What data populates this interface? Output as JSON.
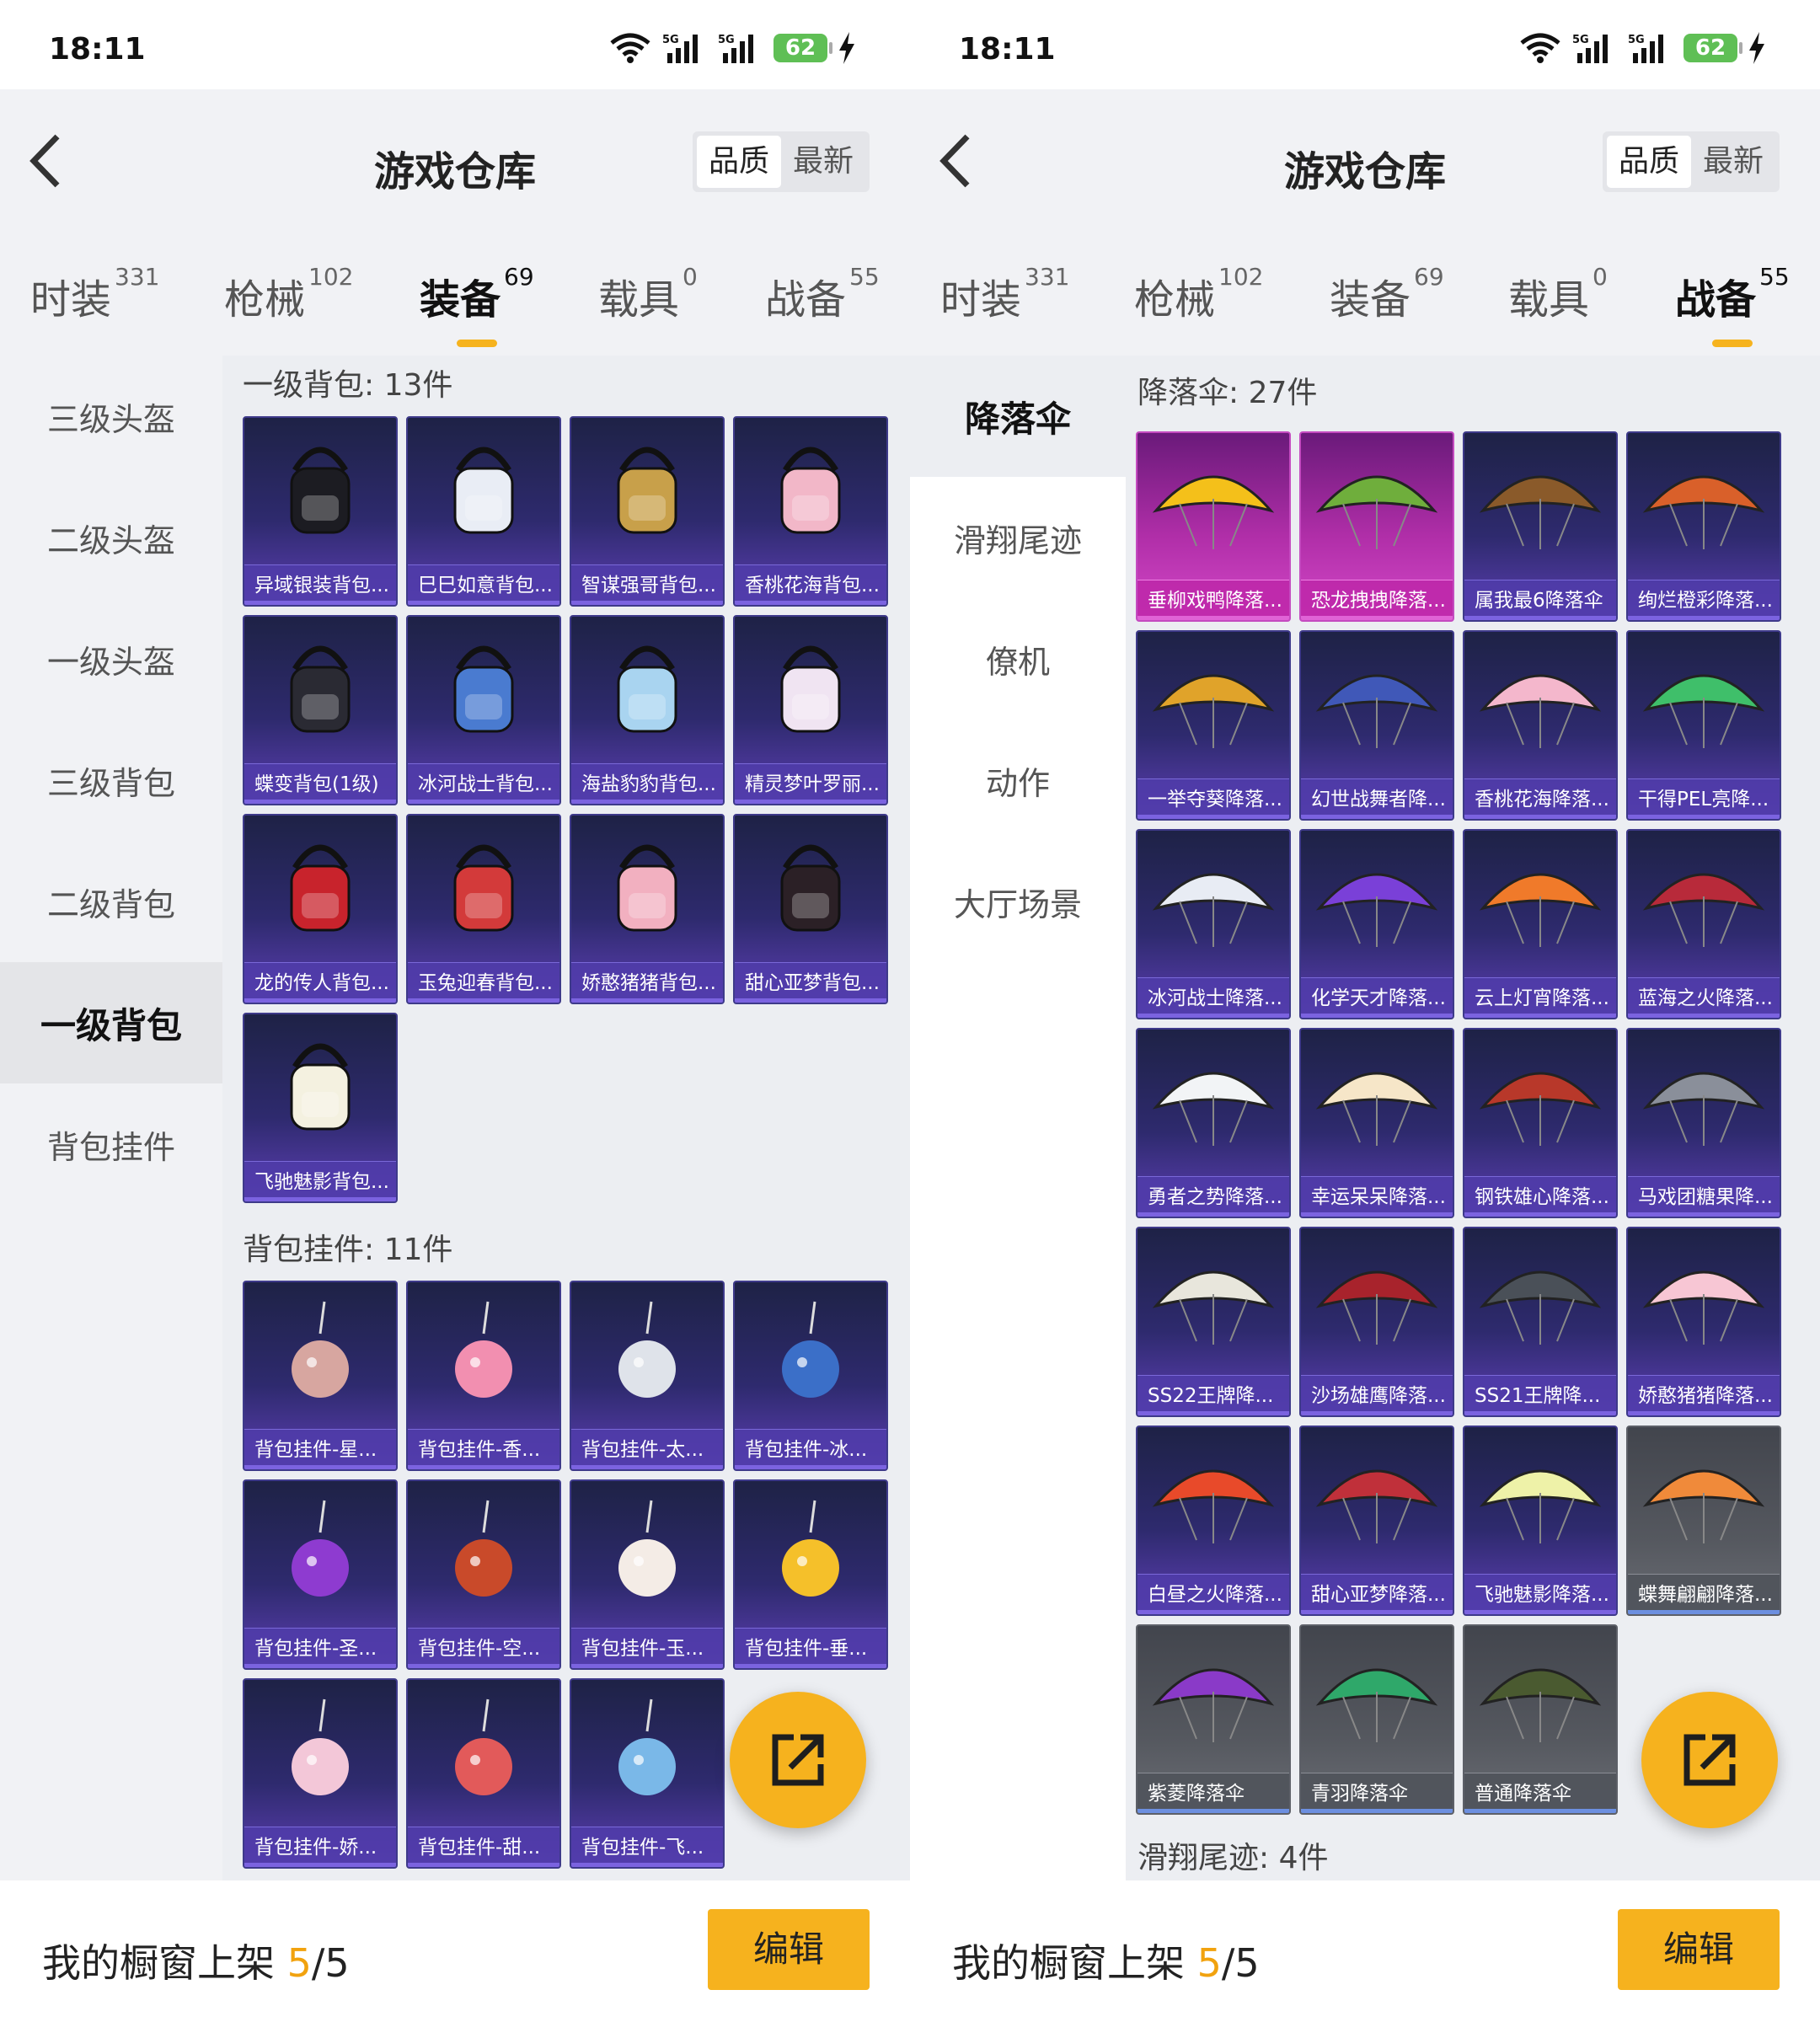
{
  "status": {
    "time": "18:11",
    "battery": "62",
    "net1": "5G",
    "net2": "5G"
  },
  "header": {
    "title": "游戏仓库",
    "sort_quality": "品质",
    "sort_newest": "最新"
  },
  "tabs": [
    {
      "label": "时装",
      "count": "331"
    },
    {
      "label": "枪械",
      "count": "102"
    },
    {
      "label": "装备",
      "count": "69"
    },
    {
      "label": "载具",
      "count": "0"
    },
    {
      "label": "战备",
      "count": "55"
    }
  ],
  "panel1": {
    "active_tab": "装备",
    "sidebar": [
      "三级头盔",
      "二级头盔",
      "一级头盔",
      "三级背包",
      "二级背包",
      "一级背包",
      "背包挂件"
    ],
    "selected_sidebar": "一级背包",
    "section1": {
      "title": "一级背包: 13件",
      "items": [
        "异域银装背包...",
        "巳巳如意背包...",
        "智谋强哥背包...",
        "香桃花海背包...",
        "蝶变背包(1级)",
        "冰河战士背包...",
        "海盐豹豹背包...",
        "精灵梦叶罗丽...",
        "龙的传人背包...",
        "玉兔迎春背包...",
        "娇憨猪猪背包...",
        "甜心亚梦背包...",
        "飞驰魅影背包..."
      ]
    },
    "section2": {
      "title": "背包挂件: 11件",
      "items": [
        "背包挂件-星...",
        "背包挂件-香...",
        "背包挂件-太...",
        "背包挂件-冰...",
        "背包挂件-圣...",
        "背包挂件-空...",
        "背包挂件-玉...",
        "背包挂件-垂...",
        "背包挂件-娇...",
        "背包挂件-甜...",
        "背包挂件-飞..."
      ]
    }
  },
  "panel2": {
    "active_tab": "战备",
    "sidebar": [
      "降落伞",
      "滑翔尾迹",
      "僚机",
      "动作",
      "大厅场景"
    ],
    "selected_sidebar": "降落伞",
    "section1": {
      "title": "降落伞: 27件",
      "items": [
        "垂柳戏鸭降落...",
        "恐龙拽拽降落...",
        "属我最6降落伞",
        "绚烂橙彩降落...",
        "一举夺葵降落...",
        "幻世战舞者降...",
        "香桃花海降落...",
        "干得PEL亮降...",
        "冰河战士降落...",
        "化学天才降落...",
        "云上灯宵降落...",
        "蓝海之火降落...",
        "勇者之势降落...",
        "幸运呆呆降落...",
        "钢铁雄心降落...",
        "马戏团糖果降...",
        "SS22王牌降...",
        "沙场雄鹰降落...",
        "SS21王牌降...",
        "娇憨猪猪降落...",
        "白昼之火降落...",
        "甜心亚梦降落...",
        "飞驰魅影降落...",
        "蝶舞翩翩降落...",
        "紫菱降落伞",
        "青羽降落伞",
        "普通降落伞"
      ]
    },
    "section2": {
      "title": "滑翔尾迹: 4件"
    }
  },
  "bottom": {
    "shelf_label": "我的橱窗上架 ",
    "shelf_current": "5",
    "shelf_total": "/5",
    "edit": "编辑"
  },
  "colors": {
    "accent": "#f6b21e",
    "card_purple": "#2e2a6e",
    "card_pink": "#b02ea8",
    "card_grey": "#55585f"
  }
}
